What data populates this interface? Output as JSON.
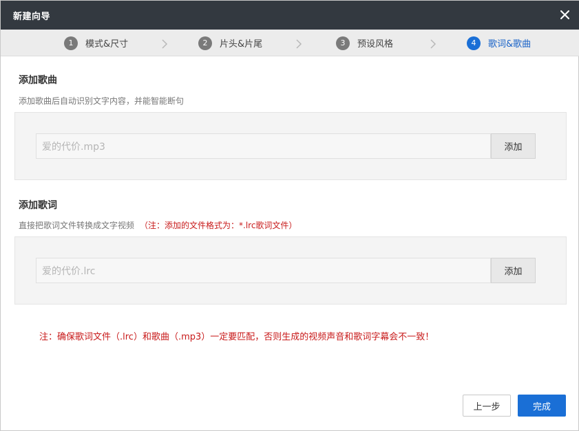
{
  "dialog": {
    "title": "新建向导",
    "close_icon": "close-icon"
  },
  "steps": [
    {
      "num": "1",
      "label": "模式&尺寸",
      "active": false
    },
    {
      "num": "2",
      "label": "片头&片尾",
      "active": false
    },
    {
      "num": "3",
      "label": "预设风格",
      "active": false
    },
    {
      "num": "4",
      "label": "歌词&歌曲",
      "active": true
    }
  ],
  "song": {
    "title": "添加歌曲",
    "desc": "添加歌曲后自动识别文字内容，并能智能断句",
    "placeholder": "爱的代价.mp3",
    "add_label": "添加"
  },
  "lyrics": {
    "title": "添加歌词",
    "desc": "直接把歌词文件转换成文字视频",
    "note": "（注：添加的文件格式为：*.lrc歌词文件）",
    "placeholder": "爱的代价.lrc",
    "add_label": "添加"
  },
  "warning": "注：确保歌词文件（.lrc）和歌曲（.mp3）一定要匹配，否则生成的视频声音和歌词字幕会不一致！",
  "footer": {
    "prev_label": "上一步",
    "done_label": "完成"
  },
  "colors": {
    "titlebar": "#333940",
    "accent": "#1a6fd6",
    "warning": "#c81a1a"
  }
}
